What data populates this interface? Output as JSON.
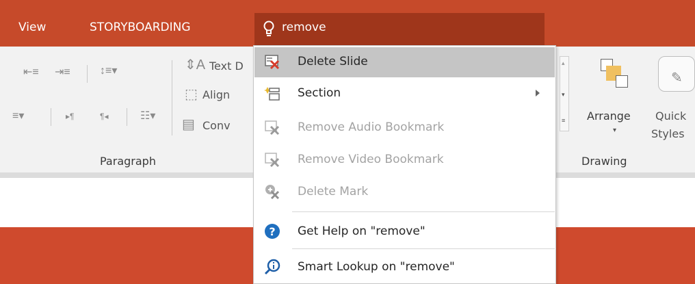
{
  "tabs": [
    {
      "label": "View"
    },
    {
      "label": "STORYBOARDING"
    }
  ],
  "tell_me": {
    "query": "remove",
    "icon": "lightbulb-icon"
  },
  "ribbon": {
    "paragraph_group_label": "Paragraph",
    "drawing_group_label": "Drawing",
    "text_direction_label": "Text D",
    "align_text_label": "Align",
    "convert_label": "Conv",
    "arrange_label": "Arrange",
    "quick_styles_label_1": "Quick",
    "quick_styles_label_2": "Styles"
  },
  "menu": {
    "items": [
      {
        "label": "Delete Slide",
        "icon": "delete-slide-icon",
        "enabled": true,
        "highlighted": true
      },
      {
        "label": "Section",
        "icon": "section-icon",
        "enabled": true,
        "has_submenu": true
      },
      {
        "label": "Remove Audio Bookmark",
        "icon": "remove-bookmark-icon",
        "enabled": false
      },
      {
        "label": "Remove Video Bookmark",
        "icon": "remove-bookmark-icon",
        "enabled": false
      },
      {
        "label": "Delete Mark",
        "icon": "delete-mark-icon",
        "enabled": false
      },
      {
        "label": "Get Help on \"remove\"",
        "icon": "help-icon",
        "enabled": true
      },
      {
        "label": "Smart Lookup on \"remove\"",
        "icon": "smart-lookup-icon",
        "enabled": true
      }
    ]
  },
  "colors": {
    "tab_bar": "#c64a2a",
    "tell_me_box": "#9f361b",
    "ribbon": "#f2f2f2",
    "menu_highlight": "#c5c5c5",
    "slide_area": "#cf4a2d"
  }
}
